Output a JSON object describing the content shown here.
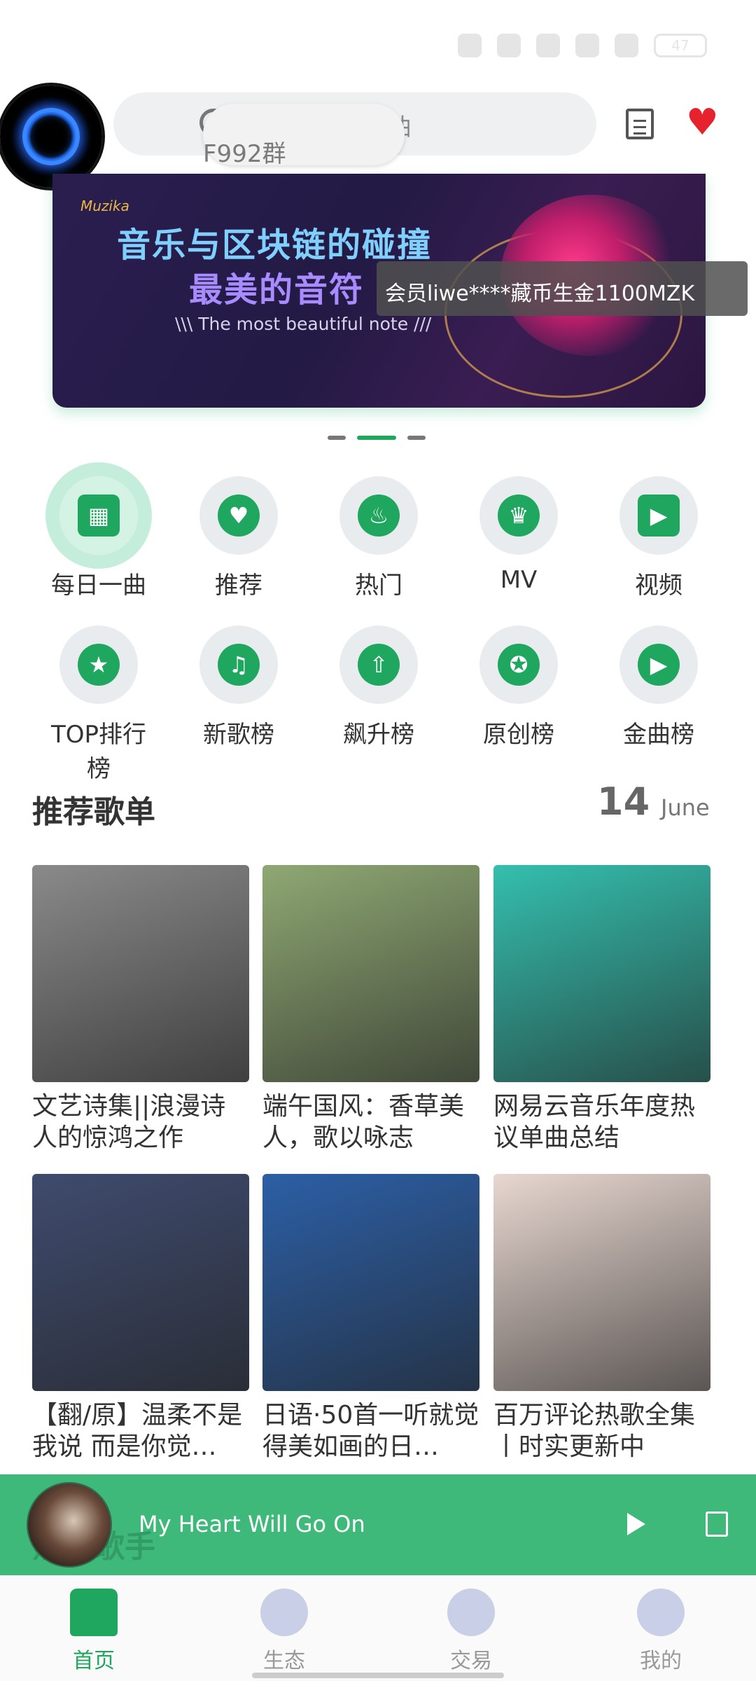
{
  "status": {
    "battery": "47"
  },
  "search": {
    "placeholder": "歌曲",
    "overlay_text": "F992群"
  },
  "banner": {
    "logo": "Muzika",
    "line1": "音乐与区块链的碰撞",
    "line2": "最美的音符",
    "subtitle": "\\\\\\  The most beautiful note  ///",
    "toast": "会员liwe****藏币生金1100MZK",
    "page_count": 3,
    "active_page": 2
  },
  "grid": [
    {
      "label": "每日一曲",
      "icon": "calendar-icon",
      "glyph": "▦",
      "active": true
    },
    {
      "label": "推荐",
      "icon": "heart-icon",
      "glyph": "♥"
    },
    {
      "label": "热门",
      "icon": "flame-icon",
      "glyph": "♨"
    },
    {
      "label": "MV",
      "icon": "trophy-icon",
      "glyph": "♛"
    },
    {
      "label": "视频",
      "icon": "video-icon",
      "glyph": "▶"
    },
    {
      "label": "TOP排行榜",
      "icon": "shield-star-icon",
      "glyph": "★"
    },
    {
      "label": "新歌榜",
      "icon": "music-note-icon",
      "glyph": "♫"
    },
    {
      "label": "飙升榜",
      "icon": "arrow-up-icon",
      "glyph": "⇧"
    },
    {
      "label": "原创榜",
      "icon": "medal-icon",
      "glyph": "✪"
    },
    {
      "label": "金曲榜",
      "icon": "play-circle-icon",
      "glyph": "▶"
    }
  ],
  "section": {
    "title": "推荐歌单",
    "day": "14",
    "month": "June"
  },
  "playlists": [
    {
      "title": "文艺诗集||浪漫诗人的惊鸿之作",
      "color": "#8a8a8a"
    },
    {
      "title": "端午国风：香草美人，歌以咏志",
      "color": "#8fa873"
    },
    {
      "title": "网易云音乐年度热议单曲总结",
      "color": "#34bfae"
    },
    {
      "title": "【翻/原】温柔不是我说 而是你觉…",
      "color": "#3f4b6e"
    },
    {
      "title": "日语·50首一听就觉得美如画的日…",
      "color": "#2c5fa6"
    },
    {
      "title": "百万评论热歌全集丨时实更新中",
      "color": "#e8d7d0"
    }
  ],
  "player": {
    "song": "My Heart Will Go On",
    "under_text": "热门歌手"
  },
  "tabs": [
    {
      "label": "首页",
      "active": true
    },
    {
      "label": "生态"
    },
    {
      "label": "交易"
    },
    {
      "label": "我的"
    }
  ]
}
